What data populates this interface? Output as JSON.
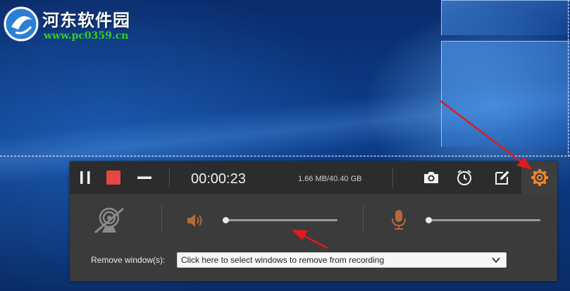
{
  "watermark": {
    "title": "河东软件园",
    "url": "www.pc0359.cn"
  },
  "toolbar": {
    "pause_icon": "pause-icon",
    "stop_icon": "stop-icon",
    "minimize_icon": "minimize-icon",
    "timer": "00:00:23",
    "file_size": "1.66 MB/40.40 GB",
    "camera_icon": "camera-icon",
    "schedule_icon": "clock-icon",
    "edit_icon": "edit-icon",
    "settings_icon": "gear-icon"
  },
  "controls": {
    "webcam_icon": "webcam-off-icon",
    "system_sound_icon": "speaker-icon",
    "system_sound_level": 0.0,
    "microphone_icon": "microphone-icon",
    "microphone_level": 0.0
  },
  "remove_window": {
    "label": "Remove window(s):",
    "select_text": "Click here to select windows to remove from recording"
  },
  "colors": {
    "stop": "#e94545",
    "accent": "#f0852d",
    "speaker": "#b5683a",
    "annotation": "#e01b1b"
  }
}
